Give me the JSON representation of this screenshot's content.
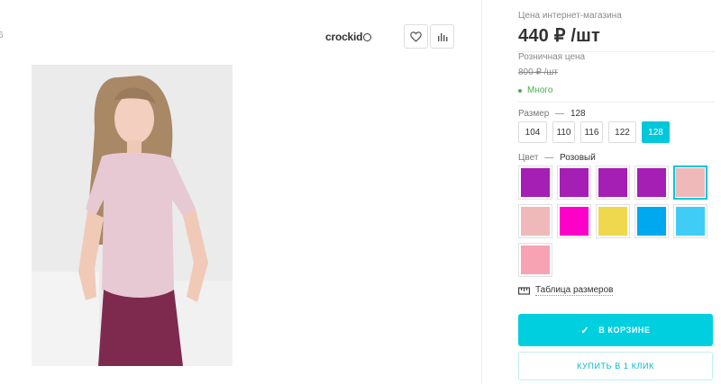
{
  "gallery": {
    "edge_char": "6",
    "brand": "crockid",
    "favorite_icon": "heart-icon",
    "compare_icon": "bar-chart-icon",
    "photo_description_icon": "product-photo"
  },
  "product": {
    "online_price_label": "Цена интернет-магазина",
    "online_price": "440 ₽ /шт",
    "retail_price_label": "Розничная цена",
    "retail_price": "800 ₽ /шт",
    "stock": "Много",
    "size_label": "Размер",
    "size_separator": "—",
    "size_selected": "128",
    "sizes": [
      "104",
      "110",
      "116",
      "122",
      "128"
    ],
    "color_label": "Цвет",
    "color_separator": "—",
    "color_selected": "Розовый",
    "colors": [
      "#a51fb5",
      "#a51fb5",
      "#a51fb5",
      "#a51fb5",
      "#f0b9b9",
      "#f0b9b9",
      "#ff00c8",
      "#f0d84e",
      "#00a8f0",
      "#3fcdf7",
      "#f7a3b4"
    ],
    "active_color_index": 4,
    "size_table_link": "Таблица размеров",
    "size_table_icon": "ruler-icon",
    "cart_button": "В КОРЗИНЕ",
    "cart_icon": "check-icon",
    "one_click_button": "КУПИТЬ В 1 КЛИК",
    "accent_color": "#00cfe0"
  }
}
